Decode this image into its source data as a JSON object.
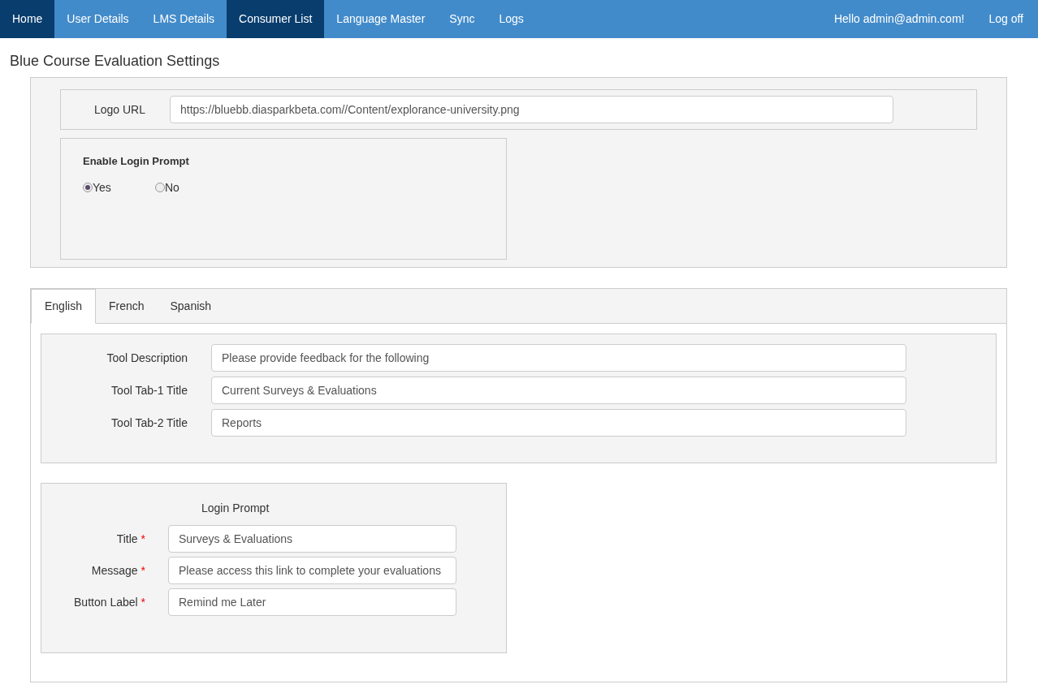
{
  "nav": {
    "items": [
      {
        "label": "Home",
        "selected": true
      },
      {
        "label": "User Details",
        "selected": false
      },
      {
        "label": "LMS Details",
        "selected": false
      },
      {
        "label": "Consumer List",
        "selected": true
      },
      {
        "label": "Language Master",
        "selected": false
      },
      {
        "label": "Sync",
        "selected": false
      },
      {
        "label": "Logs",
        "selected": false
      }
    ],
    "greeting": "Hello admin@admin.com!",
    "logoff": "Log off"
  },
  "page_title": "Blue Course Evaluation Settings",
  "logo_url": {
    "label": "Logo URL",
    "value": "https://bluebb.diasparkbeta.com//Content/explorance-university.png"
  },
  "enable_login_prompt": {
    "label": "Enable Login Prompt",
    "options": [
      {
        "label": "Yes",
        "selected": true
      },
      {
        "label": "No",
        "selected": false
      }
    ]
  },
  "tabs": [
    {
      "label": "English",
      "selected": true
    },
    {
      "label": "French",
      "selected": false
    },
    {
      "label": "Spanish",
      "selected": false
    }
  ],
  "tool_fields": [
    {
      "label": "Tool Description",
      "value": "Please provide feedback for the following"
    },
    {
      "label": "Tool Tab-1 Title",
      "value": "Current Surveys & Evaluations"
    },
    {
      "label": "Tool Tab-2 Title",
      "value": "Reports"
    }
  ],
  "login_prompt": {
    "title": "Login Prompt",
    "fields": [
      {
        "label": "Title",
        "required_mark": "*",
        "value": "Surveys & Evaluations"
      },
      {
        "label": "Message",
        "required_mark": "*",
        "value": "Please access this link to complete your evaluations"
      },
      {
        "label": "Button Label",
        "required_mark": "*",
        "value": "Remind me Later"
      }
    ]
  }
}
